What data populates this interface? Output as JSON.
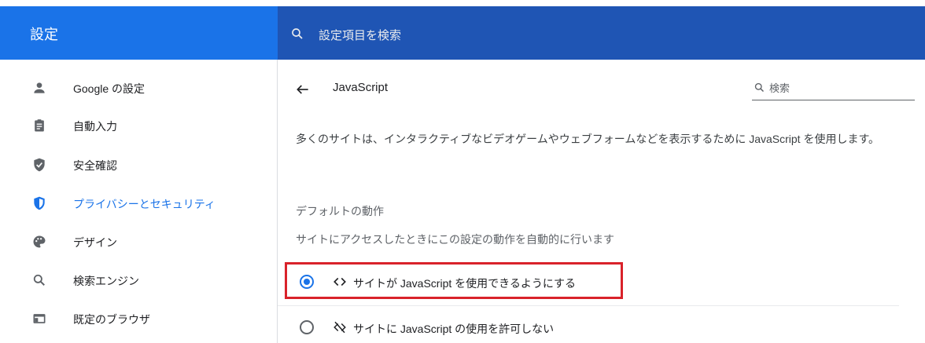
{
  "header": {
    "title": "設定",
    "search_placeholder": "設定項目を検索"
  },
  "sidebar": {
    "items": [
      {
        "label": "Google の設定",
        "icon": "person-icon"
      },
      {
        "label": "自動入力",
        "icon": "clipboard-icon"
      },
      {
        "label": "安全確認",
        "icon": "shield-check-icon"
      },
      {
        "label": "プライバシーとセキュリティ",
        "icon": "shield-icon",
        "active": true
      },
      {
        "label": "デザイン",
        "icon": "palette-icon"
      },
      {
        "label": "検索エンジン",
        "icon": "search-icon"
      },
      {
        "label": "既定のブラウザ",
        "icon": "browser-icon"
      }
    ]
  },
  "main": {
    "title": "JavaScript",
    "search_placeholder": "検索",
    "description": "多くのサイトは、インタラクティブなビデオゲームやウェブフォームなどを表示するために JavaScript を使用します。",
    "default_heading": "デフォルトの動作",
    "default_sub": "サイトにアクセスしたときにこの設定の動作を自動的に行います",
    "options": [
      {
        "label": "サイトが JavaScript を使用できるようにする",
        "icon": "code-icon",
        "checked": true
      },
      {
        "label": "サイトに JavaScript の使用を許可しない",
        "icon": "code-off-icon",
        "checked": false
      }
    ]
  },
  "colors": {
    "accent": "#1a73e8",
    "header_search": "#1f55b4",
    "highlight": "#d9222a"
  }
}
